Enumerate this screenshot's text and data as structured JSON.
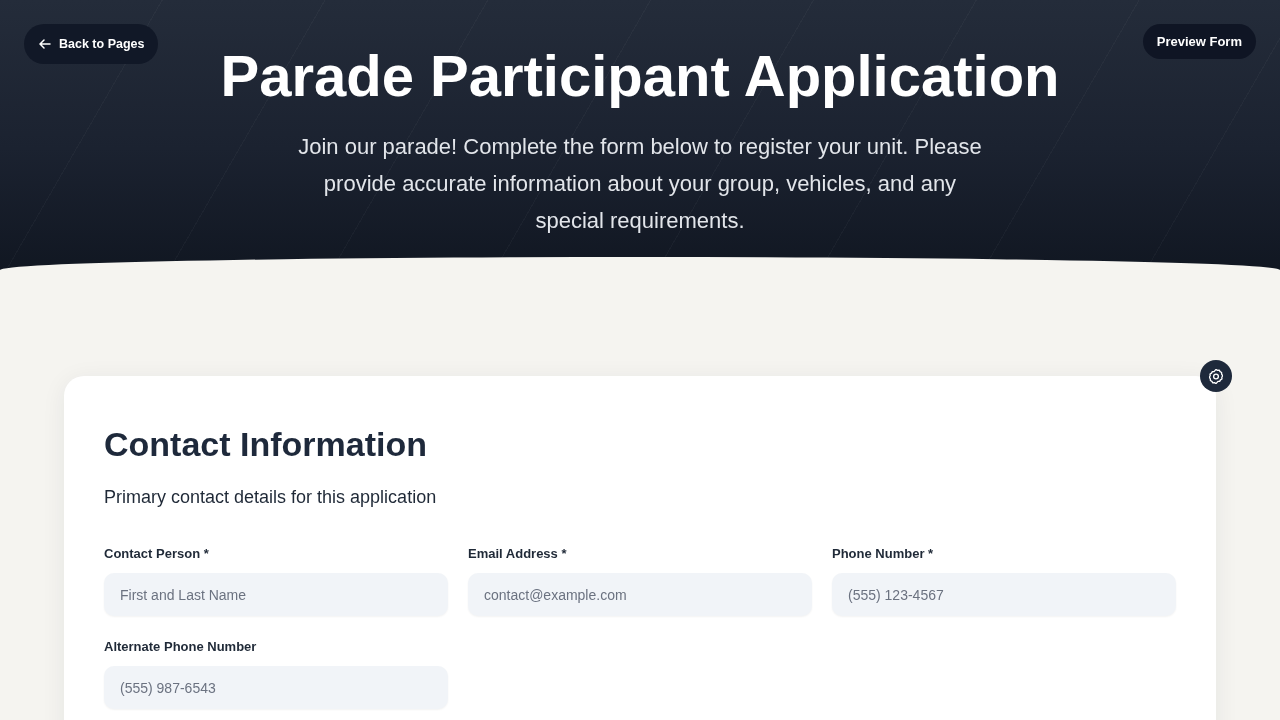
{
  "header": {
    "back_button": "Back to Pages",
    "preview_button": "Preview Form",
    "title": "Parade Participant Application",
    "subtitle": "Join our parade! Complete the form below to register your unit. Please provide accurate information about your group, vehicles, and any special requirements."
  },
  "form_section": {
    "title": "Contact Information",
    "description": "Primary contact details for this application",
    "fields": [
      {
        "label": "Contact Person *",
        "placeholder": "First and Last Name"
      },
      {
        "label": "Email Address *",
        "placeholder": "contact@example.com"
      },
      {
        "label": "Phone Number *",
        "placeholder": "(555) 123-4567"
      },
      {
        "label": "Alternate Phone Number",
        "placeholder": "(555) 987-6543"
      }
    ]
  }
}
